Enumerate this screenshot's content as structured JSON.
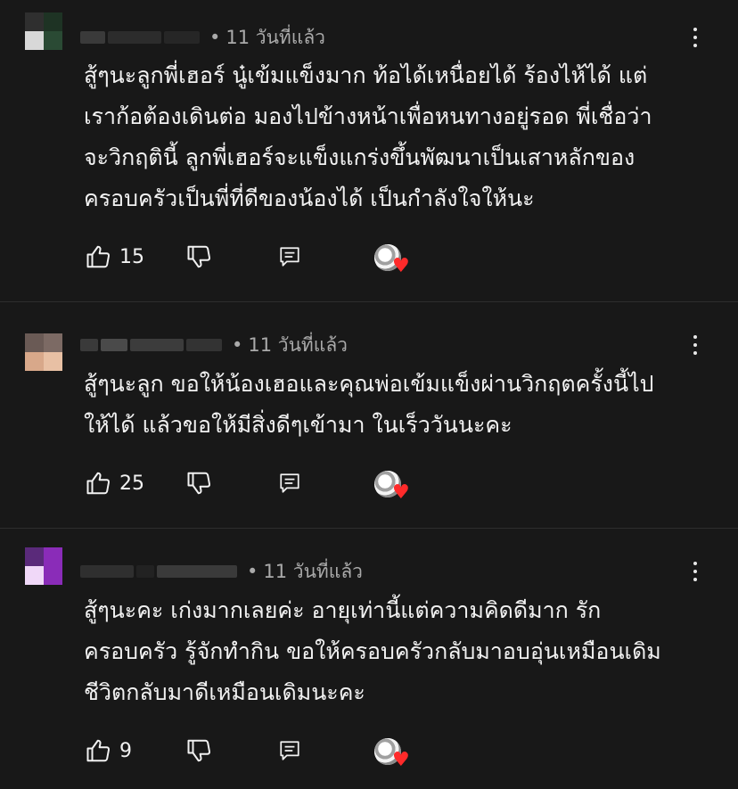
{
  "comments": [
    {
      "time_sep": "•",
      "time": "11 วันที่แล้ว",
      "lines": [
        "สู้ๆนะลูกพี่เฮอร์  นู๋เข้มแข็งมาก  ท้อได้เหนื่อยได้ ร้องไห้ได้  แต่",
        "เราก้อต้องเดินต่อ มองไปข้างหน้าเพื่อหนทางอยู่รอด   พี่เชื่อว่า",
        "จะวิกฤตินี้ ลูกพี่เฮอร์จะแข็งแกร่งขึ้นพัฒนาเป็นเสาหลักของ",
        "ครอบครัวเป็นพี่ที่ดีของน้องได้  เป็นกำลังใจให้นะ"
      ],
      "likes": "15"
    },
    {
      "time_sep": "•",
      "time": "11 วันที่แล้ว",
      "lines": [
        "สู้ๆนะลูก ขอให้น้องเฮอและคุณพ่อเข้มแข็งผ่านวิกฤตครั้งนี้ไป",
        "ให้ได้ แล้วขอให้มีสิ่งดีๆเข้ามา ในเร็ววันนะคะ"
      ],
      "likes": "25"
    },
    {
      "time_sep": "•",
      "time": "11 วันที่แล้ว",
      "lines": [
        "สู้ๆนะคะ เก่งมากเลยค่ะ อายุเท่านี้แต่ความคิดดีมาก รัก",
        "ครอบครัว รู้จักทำกิน ขอให้ครอบครัวกลับมาอบอุ่นเหมือนเดิม",
        "ชีวิตกลับมาดีเหมือนเดิมนะคะ"
      ],
      "likes": "9"
    }
  ],
  "icons": {
    "like": "thumbs-up-icon",
    "dislike": "thumbs-down-icon",
    "reply": "reply-comment-icon",
    "more": "more-vert-icon",
    "creator_heart": "creator-heart-icon"
  },
  "colors": {
    "background": "#181818",
    "text": "#f1f1f1",
    "meta": "#aaaaaa",
    "heart": "#ff2a2a"
  }
}
